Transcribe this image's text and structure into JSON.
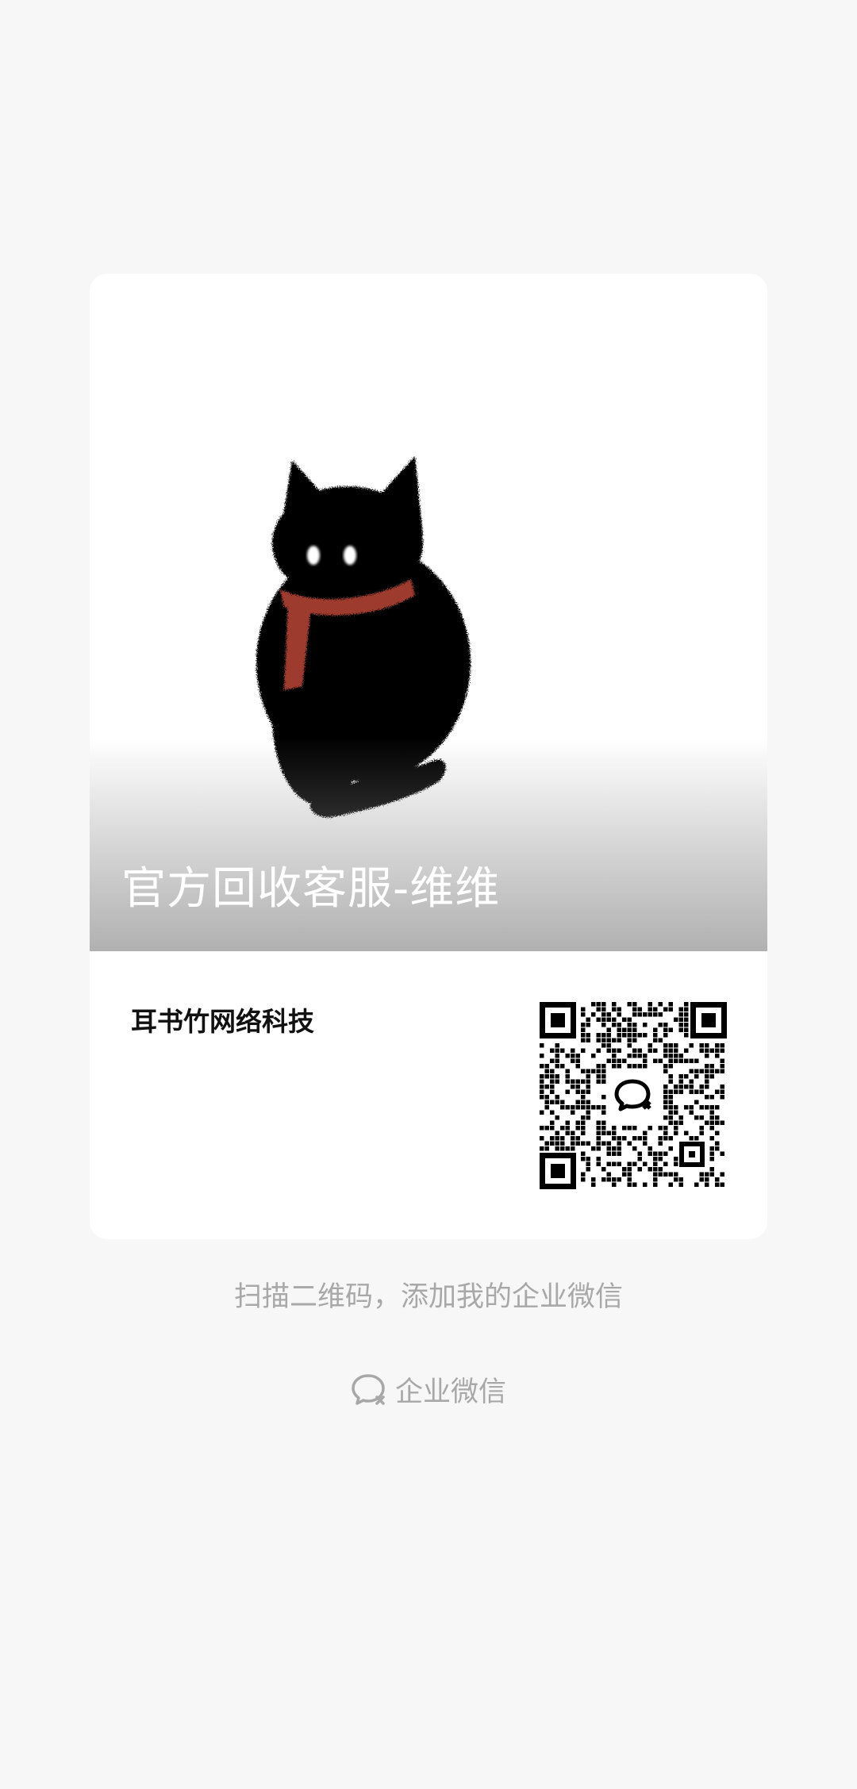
{
  "card": {
    "display_name": "官方回收客服-维维",
    "company": "耳书竹网络科技"
  },
  "hint": "扫描二维码，添加我的企业微信",
  "brand": {
    "icon": "wecom-icon",
    "label": "企业微信"
  },
  "colors": {
    "background": "#f7f7f7",
    "card": "#ffffff",
    "muted_text": "#a8a8a8",
    "scarf": "#9c3b2e"
  }
}
